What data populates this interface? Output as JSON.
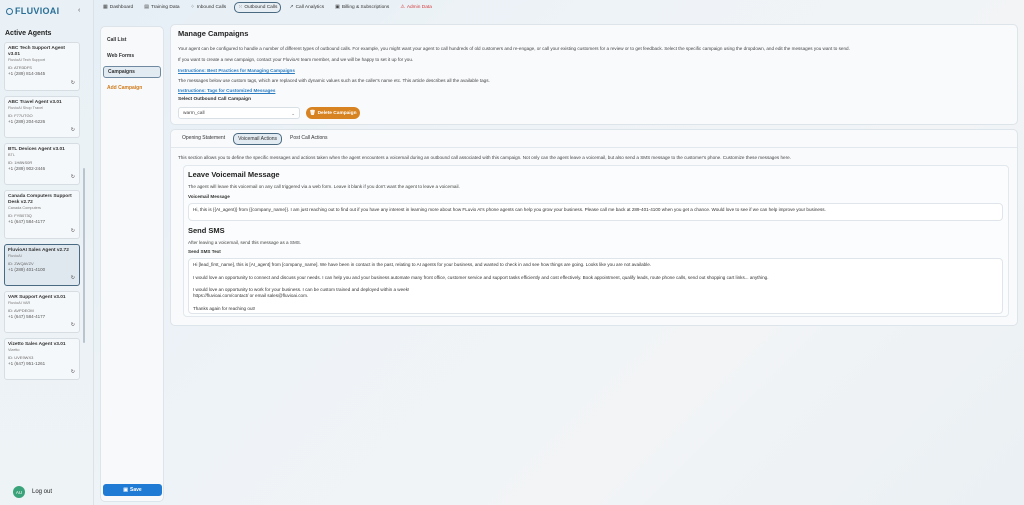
{
  "brand": {
    "name": "FLUVIOAI"
  },
  "sidebar": {
    "title": "Active Agents",
    "agents": [
      {
        "name": "ABC Tech Support Agent v3.01",
        "company": "FluvioAI Tech Support",
        "id": "ID: ATR3DFS",
        "phone": "+1 (289) 814-3645",
        "tall": true
      },
      {
        "name": "ABC Travel Agent v3.01",
        "company": "FluvioAI Shop Travel",
        "id": "ID: F77UTGO",
        "phone": "+1 (289) 204-6226",
        "tall": false
      },
      {
        "name": "BTL Devices Agent v3.01",
        "company": "BTL",
        "id": "ID: 1H8NS0R",
        "phone": "+1 (289) 902-2446",
        "tall": false
      },
      {
        "name": "Canada Computers Support Desk v2.72",
        "company": "Canada Computers",
        "id": "ID: FYB073Q",
        "phone": "+1 (647) 584-4177",
        "tall": true
      },
      {
        "name": "FluvioAI Sales Agent v2.72",
        "company": "FluvioAI",
        "id": "ID: ZWQAVZV",
        "phone": "+1 (289) 401-4100",
        "tall": false,
        "selected": true
      },
      {
        "name": "VAR Support Agent v3.01",
        "company": "FluvioAI VAR",
        "id": "ID: AVPDEOM",
        "phone": "+1 (647) 584-4177",
        "tall": false
      },
      {
        "name": "Vizetto Sales Agent v3.01",
        "company": "Vizetto",
        "id": "ID: UVE9WX3",
        "phone": "+1 (647) 951-1261",
        "tall": false
      }
    ],
    "logout": {
      "avatar_initials": "AU",
      "label": "Log out"
    }
  },
  "topnav": [
    {
      "label": "Dashboard",
      "icon": "grid-icon",
      "glyph": "▦"
    },
    {
      "label": "Training Data",
      "icon": "database-icon",
      "glyph": "▤"
    },
    {
      "label": "Inbound Calls",
      "icon": "inbound-icon",
      "glyph": "⁘"
    },
    {
      "label": "Outbound Calls",
      "icon": "outbound-icon",
      "glyph": "⁙",
      "active": true
    },
    {
      "label": "Call Analytics",
      "icon": "analytics-icon",
      "glyph": "↗"
    },
    {
      "label": "Billing & Subscriptions",
      "icon": "billing-icon",
      "glyph": "▣"
    },
    {
      "label": "Admin Data",
      "icon": "admin-icon",
      "glyph": "⚠",
      "danger": true
    }
  ],
  "subnav": {
    "items": [
      "Call List",
      "Web Forms",
      "Campaigns",
      "Add Campaign"
    ],
    "save_label": "Save"
  },
  "campaigns": {
    "title": "Manage Campaigns",
    "desc1": "Your agent can be configured to handle a number of different types of outbound calls. For example, you might want your agent to call hundreds of old customers and re-engage, or call your existing customers for a review or to get feedback. Select the specific campaign using the dropdown, and edit the messages you want to send.",
    "desc2": "If you want to create a new campaign, contact your FluvioAI team member, and we will be happy to set it up for you.",
    "link1": "Instructions: Best Practices for Managing Campaigns",
    "desc3": "The messages below use custom tags, which are replaced with dynamic values such as the caller's name etc. This article describes all the available tags.",
    "link2": "Instructions: Tags for Customized Messages",
    "select_label": "Select Outbound Call Campaign",
    "selected_campaign": "warm_call",
    "delete_label": "Delete Campaign"
  },
  "tabs": [
    "Opening Statement",
    "Voicemail Actions",
    "Post Call Actions"
  ],
  "voicemail": {
    "intro": "This section allows you to define the specific messages and actions taken when the agent encounters a voicemail during an outbound call associated with this campaign. Not only can the agent leave a voicemail, but also send a SMS message to the customer's phone. Customize these messages here.",
    "leave_title": "Leave Voicemail Message",
    "leave_desc": "The agent will leave this voicemail on any call triggered via a web form. Leave it blank if you don't want the agent to leave a voicemail.",
    "vm_label": "Voicemail Message",
    "vm_text": "Hi, this is {{AI_agent}} from {{company_name}}. I am just reaching out to find out if you have any interest in learning more about how FLuvio AI's phone agents can help you grow your business. Please call me back at 289-401-4100 when you get a chance. Would love to see if we can help improve your business.",
    "sms_title": "Send SMS",
    "sms_desc": "After leaving a voicemail, send this message as a SMS.",
    "sms_label": "Send SMS Text",
    "sms_lines": [
      "Hi [lead_first_name], this is [AI_agent] from [company_name]. We have been in contact in the past, relating to AI agents for your business, and wanted to check in and see how things are going. Looks like you are not available.",
      "",
      "I would love an opportunity to connect and discuss your needs. I can help you and your business automate many front office, customer service and support tasks efficiently and cost effectively. Book appointment, qualify leads, route phone calls, send out shopping cart links... anything.",
      "",
      "I would love an opportunity to work for your business. I can be custom trained and deployed within a week!",
      "https://fluvioai.com/contact/ or email sales@fluvioai.com.",
      "",
      "Thanks again for reaching out!"
    ]
  }
}
